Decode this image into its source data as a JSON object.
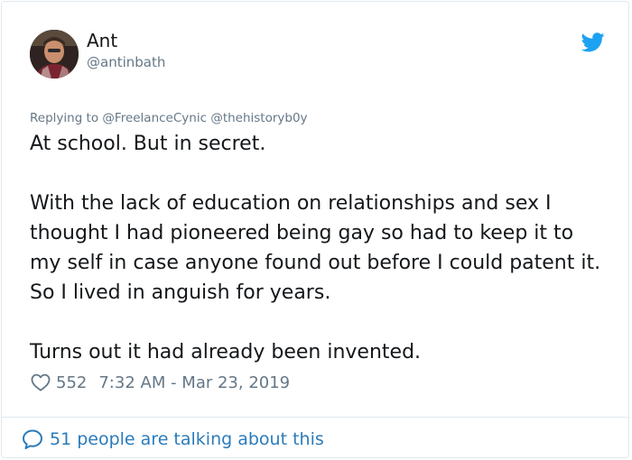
{
  "tweet": {
    "author": {
      "display_name": "Ant",
      "handle": "@antinbath"
    },
    "replying_prefix": "Replying to",
    "replying_to": [
      "@FreelanceCynic",
      "@thehistoryb0y"
    ],
    "paragraphs": [
      "At school. But in secret.",
      "With the lack of education on relationships and sex I thought I had pioneered being gay so had to keep it to my self in case anyone found out before I could patent it. So I lived in anguish for years.",
      "Turns out it had already been invented."
    ],
    "likes": "552",
    "timestamp": "7:32 AM - Mar 23, 2019"
  },
  "footer": {
    "conversation_label": "51 people are talking about this"
  },
  "icons": {
    "brand": "twitter-bird-icon",
    "like": "heart-icon",
    "conversation": "speech-bubble-icon"
  },
  "colors": {
    "twitter_blue": "#1da1f2",
    "link_blue": "#2b7bb9",
    "secondary_text": "#657786",
    "primary_text": "#14171a",
    "border": "#e1e8ed"
  }
}
